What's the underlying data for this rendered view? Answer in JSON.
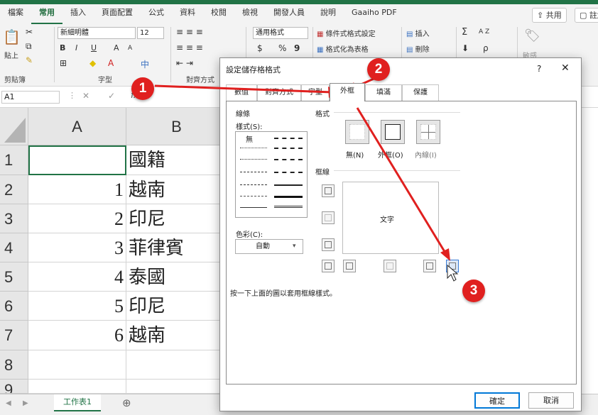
{
  "ribbon_tabs": [
    "檔案",
    "常用",
    "插入",
    "頁面配置",
    "公式",
    "資料",
    "校閱",
    "檢視",
    "開發人員",
    "說明",
    "Gaaiho PDF"
  ],
  "top_buttons": {
    "share": "共用",
    "comments": "註解"
  },
  "ribbon": {
    "clipboard": {
      "paste": "貼上",
      "label": "剪貼簿"
    },
    "font": {
      "name": "新細明體",
      "size": "12",
      "bold": "B",
      "italic": "I",
      "underline": "U",
      "grow": "A",
      "shrink": "A",
      "label": "字型"
    },
    "alignment": {
      "label": "對齊方式"
    },
    "number": {
      "format": "通用格式",
      "currency": "$",
      "percent": "%",
      "comma": "9"
    },
    "styles": {
      "conditional": "條件式格式設定",
      "as_table": "格式化為表格"
    },
    "cells": {
      "insert": "插入",
      "delete": "刪除"
    },
    "editing": {
      "sum": "Σ",
      "sort": "A Z",
      "find": "ρ"
    },
    "sensitivity": "敏感"
  },
  "namebox": "A1",
  "formula_icons": {
    "cancel": "✕",
    "enter": "✓",
    "fx": "fx"
  },
  "columns": [
    "A",
    "B"
  ],
  "rows": [
    {
      "n": "1",
      "a": "",
      "b": "國籍"
    },
    {
      "n": "2",
      "a": "1",
      "b": "越南"
    },
    {
      "n": "3",
      "a": "2",
      "b": "印尼"
    },
    {
      "n": "4",
      "a": "3",
      "b": "菲律賓"
    },
    {
      "n": "5",
      "a": "4",
      "b": "泰國"
    },
    {
      "n": "6",
      "a": "5",
      "b": "印尼"
    },
    {
      "n": "7",
      "a": "6",
      "b": "越南"
    },
    {
      "n": "8",
      "a": "",
      "b": ""
    },
    {
      "n": "9",
      "a": "",
      "b": ""
    }
  ],
  "sheet_tab": "工作表1",
  "add_sheet": "⊕",
  "dialog": {
    "title": "設定儲存格格式",
    "help": "?",
    "close": "✕",
    "tabs": [
      "數值",
      "對齊方式",
      "字型",
      "外框",
      "填滿",
      "保護"
    ],
    "active_tab": "外框",
    "line_section": "線條",
    "style_label": "樣式(S):",
    "none_label": "無",
    "color_label": "色彩(C):",
    "color_value": "自動",
    "presets_section": "格式",
    "presets": [
      "無(N)",
      "外框(O)",
      "內線(I)"
    ],
    "border_section": "框線",
    "preview_text": "文字",
    "hint": "按一下上面的圖以套用框線樣式。",
    "ok": "確定",
    "cancel": "取消"
  },
  "annotations": [
    "1",
    "2",
    "3"
  ],
  "colors": {
    "excel_green": "#217346",
    "annotation_red": "#e0201f",
    "ok_border": "#0078d7"
  }
}
